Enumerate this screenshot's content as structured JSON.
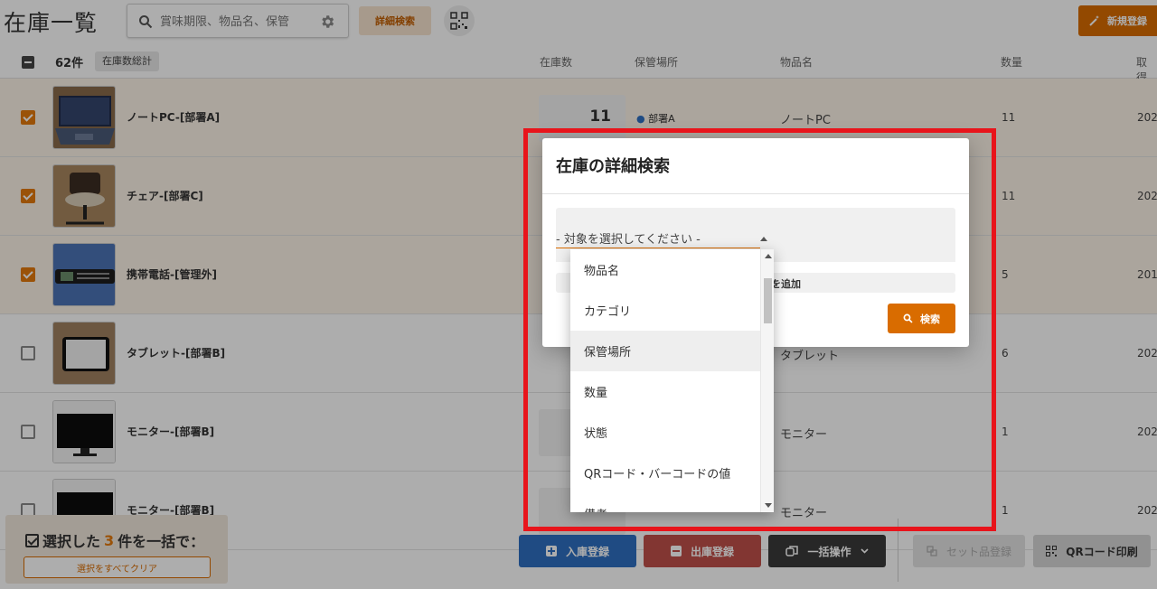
{
  "header": {
    "title": "在庫一覧",
    "search_placeholder": "賞味期限、物品名、保管",
    "detail_search_label": "詳細検索",
    "new_register_label": "新規登録"
  },
  "table": {
    "count_label": "62件",
    "total_tag": "在庫数総計",
    "columns": {
      "stock": "在庫数",
      "location": "保管場所",
      "item_name": "物品名",
      "quantity": "数量",
      "acquired": "取得"
    },
    "rows": [
      {
        "name": "ノートPC-[部署A]",
        "stock": "11",
        "location": "部署A",
        "item_name": "ノートPC",
        "quantity": "11",
        "date": "202",
        "selected": true
      },
      {
        "name": "チェア-[部署C]",
        "stock": "",
        "location": "",
        "item_name": "",
        "quantity": "11",
        "date": "202",
        "selected": true
      },
      {
        "name": "携帯電話-[管理外]",
        "stock": "",
        "location": "",
        "item_name": "",
        "quantity": "5",
        "date": "201",
        "selected": true
      },
      {
        "name": "タブレット-[部署B]",
        "stock": "",
        "location": "",
        "item_name": "タブレット",
        "quantity": "6",
        "date": "202",
        "selected": false
      },
      {
        "name": "モニター-[部署B]",
        "stock": "",
        "location": "",
        "item_name": "モニター",
        "quantity": "1",
        "date": "202",
        "selected": false
      },
      {
        "name": "モニター-[部署B]",
        "stock": "",
        "location": "",
        "item_name": "モニター",
        "quantity": "1",
        "date": "202",
        "selected": false
      }
    ]
  },
  "bottom_bar": {
    "selected_prefix": "選択した",
    "selected_count": "3",
    "selected_suffix": "件を一括で：",
    "clear_label": "選択をすべてクリア",
    "stock_in_label": "入庫登録",
    "stock_out_label": "出庫登録",
    "bulk_label": "一括操作",
    "set_register_label": "セット品登録",
    "qr_print_label": "QRコード印刷"
  },
  "modal": {
    "title": "在庫の詳細検索",
    "select_placeholder": "- 対象を選択してください -",
    "add_condition_label": "を追加",
    "search_label": "検索"
  },
  "dropdown": {
    "options": [
      "物品名",
      "カテゴリ",
      "保管場所",
      "数量",
      "状態",
      "QRコード・バーコードの値",
      "備考"
    ],
    "hovered_index": 2
  },
  "colors": {
    "accent": "#d96c00",
    "highlight_frame": "#e8141b",
    "stock_in": "#2e6fc1",
    "stock_out": "#c0504a"
  }
}
